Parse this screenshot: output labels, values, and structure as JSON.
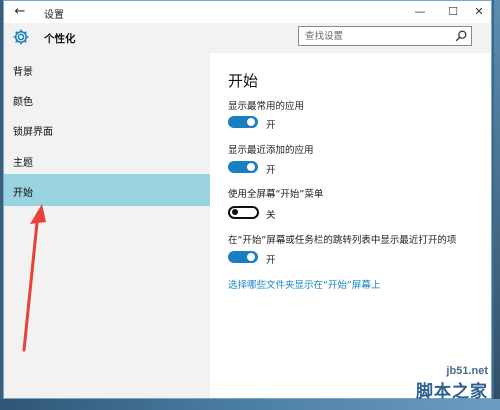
{
  "window": {
    "title": "设置"
  },
  "titlebar": {
    "back_glyph": "←",
    "minimize_glyph": "—",
    "maximize_glyph": "☐",
    "close_glyph": "✕"
  },
  "header": {
    "title": "个性化",
    "icon": "gear-icon"
  },
  "search": {
    "placeholder": "查找设置",
    "icon": "search-icon"
  },
  "sidebar": {
    "items": [
      {
        "label": "背景",
        "selected": false
      },
      {
        "label": "颜色",
        "selected": false
      },
      {
        "label": "锁屏界面",
        "selected": false
      },
      {
        "label": "主题",
        "selected": false
      },
      {
        "label": "开始",
        "selected": true
      }
    ]
  },
  "main": {
    "title": "开始",
    "settings": [
      {
        "label": "显示最常用的应用",
        "state": "开",
        "on": true
      },
      {
        "label": "显示最近添加的应用",
        "state": "开",
        "on": true
      },
      {
        "label": "使用全屏幕“开始”菜单",
        "state": "关",
        "on": false
      },
      {
        "label": "在“开始”屏幕或任务栏的跳转列表中显示最近打开的项",
        "state": "开",
        "on": true
      }
    ],
    "link": "选择哪些文件夹显示在“开始”屏幕上"
  },
  "colors": {
    "accent": "#1a7fc0",
    "selected_nav": "#99d3df",
    "link": "#1a87c8",
    "annotation_arrow": "#e8403a"
  },
  "watermark": {
    "site": "jb51.net",
    "name": "脚本之家"
  }
}
